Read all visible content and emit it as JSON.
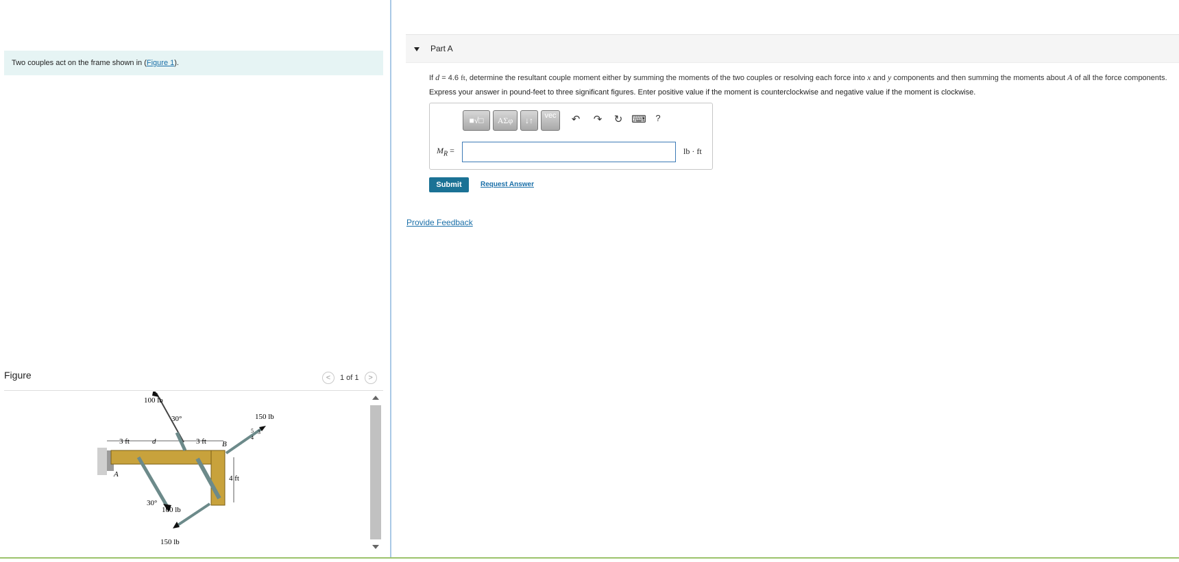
{
  "intro": {
    "text_before": "Two couples act on the frame shown in (",
    "link": "Figure 1",
    "text_after": ")."
  },
  "figure": {
    "title": "Figure",
    "pager": "1 of 1",
    "labels": {
      "force_top": "100 lb",
      "angle_top": "30°",
      "force_right_top": "150 lb",
      "dim_3ft_left": "3 ft",
      "dim_d": "d",
      "dim_3ft_right": "3 ft",
      "point_b": "B",
      "point_a": "A",
      "dim_4ft": "4 ft",
      "angle_bottom": "30°",
      "force_bottom": "100 lb",
      "force_bottom_left": "150 lb",
      "tri_5": "5",
      "tri_3": "3",
      "tri_4": "4"
    }
  },
  "part": {
    "label": "Part A",
    "q_if": "If ",
    "q_d": "d",
    "q_eq": " = 4.6 ",
    "q_ft": "ft",
    "q_mid": ", determine the resultant couple moment either by summing the moments of the two couples or resolving each force into ",
    "q_x": "x",
    "q_and": " and ",
    "q_y": "y",
    "q_rest": " components and then summing the moments about ",
    "q_A": "A",
    "q_end": " of all the force components.",
    "instruction": "Express your answer in pound-feet to three significant figures. Enter positive value if the moment is counterclockwise and negative value if the moment is clockwise."
  },
  "toolbar": {
    "templates": "■√□",
    "greek": "ΑΣφ",
    "arrows": "↓↑",
    "vec": "vec",
    "undo": "↶",
    "redo": "↷",
    "reset": "↻",
    "keyboard": "⌨",
    "help": "?"
  },
  "answer": {
    "label": "M",
    "label_sub": "R",
    "eq": " =",
    "value": "",
    "units": "lb · ft"
  },
  "actions": {
    "submit": "Submit",
    "request": "Request Answer",
    "feedback": "Provide Feedback"
  }
}
